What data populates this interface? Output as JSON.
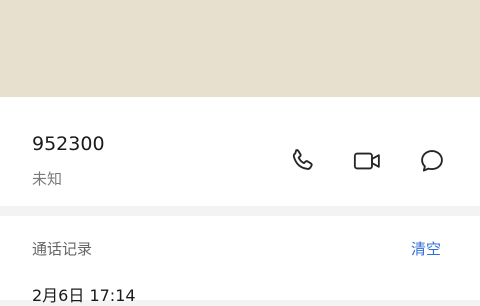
{
  "contact": {
    "number": "952300",
    "location": "未知"
  },
  "actions": {
    "call_icon": "phone-icon",
    "video_icon": "video-camera-icon",
    "message_icon": "chat-bubble-icon"
  },
  "history": {
    "title": "通话记录",
    "clear_label": "清空",
    "entries": [
      {
        "time": "2月6日 17:14"
      }
    ]
  },
  "colors": {
    "banner": "#e8e0cf",
    "accent": "#2f6fd6",
    "icon": "#262626",
    "secondary_text": "#7a7a7a"
  }
}
